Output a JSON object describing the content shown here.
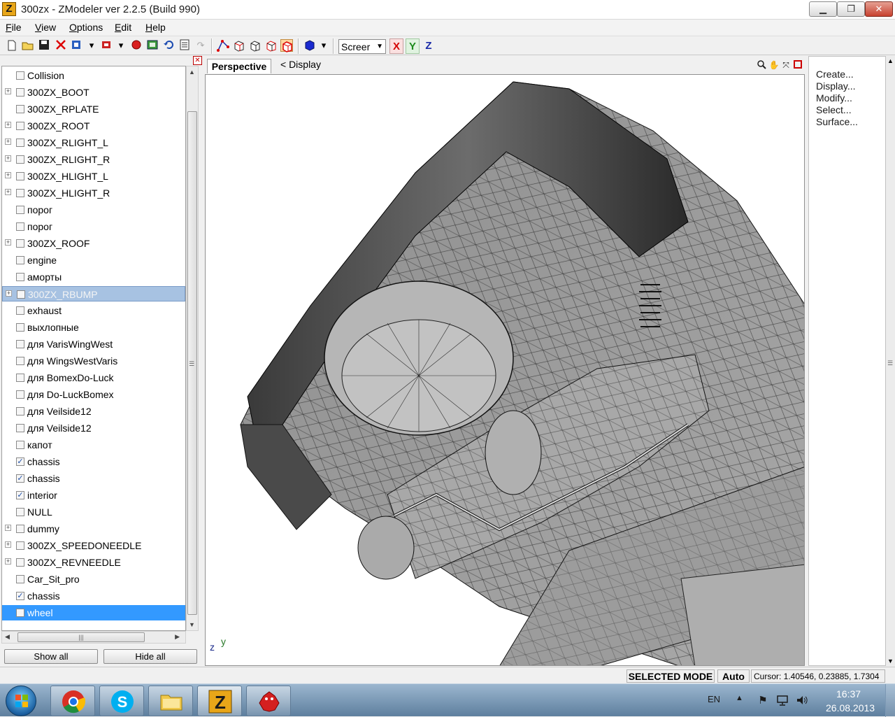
{
  "window": {
    "title": "300zx - ZModeler ver 2.2.5 (Build 990)",
    "app_icon_letter": "Z",
    "minimize_glyph": "▁",
    "maximize_glyph": "❐",
    "close_glyph": "✕"
  },
  "menu": [
    {
      "label": "File",
      "hotkey": "F",
      "rest": "ile"
    },
    {
      "label": "View",
      "hotkey": "V",
      "rest": "iew"
    },
    {
      "label": "Options",
      "hotkey": "O",
      "rest": "ptions"
    },
    {
      "label": "Edit",
      "hotkey": "E",
      "rest": "dit"
    },
    {
      "label": "Help",
      "hotkey": "H",
      "rest": "elp"
    }
  ],
  "toolbar": {
    "screen_select_value": "Screer",
    "axis_x": "X",
    "axis_y": "Y",
    "axis_z": "Z",
    "colors": {
      "x": "#d40000",
      "y": "#1a8a1a",
      "z": "#1a2aa8"
    }
  },
  "object_list": {
    "items": [
      {
        "label": "Collision",
        "expandable": false,
        "checked": false,
        "state": "normal"
      },
      {
        "label": "300ZX_BOOT",
        "expandable": true,
        "checked": false,
        "state": "normal"
      },
      {
        "label": "300ZX_RPLATE",
        "expandable": false,
        "checked": false,
        "state": "normal"
      },
      {
        "label": "300ZX_ROOT",
        "expandable": true,
        "checked": false,
        "state": "normal"
      },
      {
        "label": "300ZX_RLIGHT_L",
        "expandable": true,
        "checked": false,
        "state": "normal"
      },
      {
        "label": "300ZX_RLIGHT_R",
        "expandable": true,
        "checked": false,
        "state": "normal"
      },
      {
        "label": "300ZX_HLIGHT_L",
        "expandable": true,
        "checked": false,
        "state": "normal"
      },
      {
        "label": "300ZX_HLIGHT_R",
        "expandable": true,
        "checked": false,
        "state": "normal"
      },
      {
        "label": "порог",
        "expandable": false,
        "checked": false,
        "state": "normal"
      },
      {
        "label": "порог",
        "expandable": false,
        "checked": false,
        "state": "normal"
      },
      {
        "label": "300ZX_ROOF",
        "expandable": true,
        "checked": false,
        "state": "normal"
      },
      {
        "label": "engine",
        "expandable": false,
        "checked": false,
        "state": "normal"
      },
      {
        "label": "аморты",
        "expandable": false,
        "checked": false,
        "state": "normal"
      },
      {
        "label": "300ZX_RBUMP",
        "expandable": true,
        "checked": false,
        "state": "sel-light"
      },
      {
        "label": "exhaust",
        "expandable": false,
        "checked": false,
        "state": "normal"
      },
      {
        "label": "выхлопные",
        "expandable": false,
        "checked": false,
        "state": "normal"
      },
      {
        "label": "для VarisWingWest",
        "expandable": false,
        "checked": false,
        "state": "normal"
      },
      {
        "label": "для WingsWestVaris",
        "expandable": false,
        "checked": false,
        "state": "normal"
      },
      {
        "label": "для BomexDo-Luck",
        "expandable": false,
        "checked": false,
        "state": "normal"
      },
      {
        "label": "для Do-LuckBomex",
        "expandable": false,
        "checked": false,
        "state": "normal"
      },
      {
        "label": "для Veilside12",
        "expandable": false,
        "checked": false,
        "state": "normal"
      },
      {
        "label": "для Veilside12",
        "expandable": false,
        "checked": false,
        "state": "normal"
      },
      {
        "label": "капот",
        "expandable": false,
        "checked": false,
        "state": "normal"
      },
      {
        "label": "chassis",
        "expandable": false,
        "checked": true,
        "state": "normal"
      },
      {
        "label": "chassis",
        "expandable": false,
        "checked": true,
        "state": "normal"
      },
      {
        "label": "interior",
        "expandable": false,
        "checked": true,
        "state": "normal"
      },
      {
        "label": "NULL",
        "expandable": false,
        "checked": false,
        "state": "normal"
      },
      {
        "label": "dummy",
        "expandable": true,
        "checked": false,
        "state": "normal"
      },
      {
        "label": "300ZX_SPEEDONEEDLE",
        "expandable": true,
        "checked": false,
        "state": "normal"
      },
      {
        "label": "300ZX_REVNEEDLE",
        "expandable": true,
        "checked": false,
        "state": "normal"
      },
      {
        "label": "Car_Sit_pro",
        "expandable": false,
        "checked": false,
        "state": "normal"
      },
      {
        "label": "chassis",
        "expandable": false,
        "checked": true,
        "state": "normal"
      },
      {
        "label": "wheel",
        "expandable": false,
        "checked": false,
        "state": "sel-active"
      }
    ],
    "show_all_label": "Show all",
    "hide_all_label": "Hide all"
  },
  "viewport": {
    "tab_label": "Perspective",
    "display_label": "<  Display",
    "axis_z": "z",
    "axis_y": "y"
  },
  "commands": [
    "Create...",
    "Display...",
    "Modify...",
    "Select...",
    "Surface..."
  ],
  "status": {
    "mode": "SELECTED MODE",
    "auto": "Auto",
    "cursor": "Cursor: 1.40546, 0.23885, 1.7304"
  },
  "taskbar": {
    "apps": [
      {
        "name": "chrome-icon",
        "active": false
      },
      {
        "name": "skype-icon",
        "active": false
      },
      {
        "name": "explorer-icon",
        "active": false
      },
      {
        "name": "zmodeler-icon",
        "active": true
      },
      {
        "name": "mascot-app-icon",
        "active": false
      }
    ],
    "language": "EN",
    "time": "16:37",
    "date": "26.08.2013"
  }
}
